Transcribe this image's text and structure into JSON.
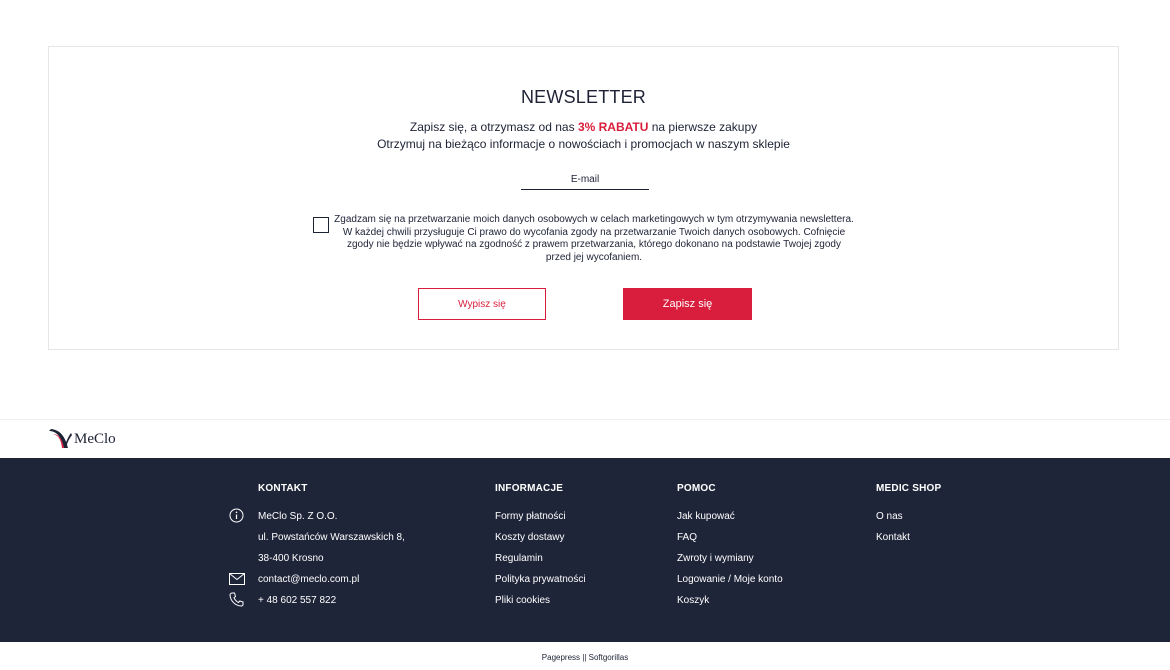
{
  "newsletter": {
    "title": "NEWSLETTER",
    "line1_prefix": "Zapisz się, a otrzymasz od nas ",
    "line1_highlight": "3% RABATU",
    "line1_suffix": " na pierwsze zakupy",
    "line2": "Otrzymuj na bieżąco informacje o nowościach i promocjach w naszym sklepie",
    "email_placeholder": "E-mail",
    "email_value": "",
    "consent_checked": false,
    "consent_text": "Zgadzam się na przetwarzanie moich danych osobowych w celach marketingowych w tym otrzymywania newslettera. W każdej chwili przysługuje Ci prawo do wycofania zgody na przetwarzanie Twoich danych osobowych. Cofnięcie zgody nie będzie wpływać na zgodność z prawem przetwarzania, którego dokonano na podstawie Twojej zgody przed jej wycofaniem.",
    "unsubscribe_label": "Wypisz się",
    "subscribe_label": "Zapisz się"
  },
  "brand": {
    "name": "MeClo"
  },
  "footer": {
    "kontakt": {
      "heading": "KONTAKT",
      "company": "MeClo Sp. Z O.O.",
      "street": "ul. Powstańców Warszawskich 8,",
      "city": "38-400 Krosno",
      "email": "contact@meclo.com.pl",
      "phone": "+ 48 602 557 822"
    },
    "informacje": {
      "heading": "INFORMACJE",
      "items": [
        "Formy płatności",
        "Koszty dostawy",
        "Regulamin",
        "Polityka prywatności",
        "Pliki cookies"
      ]
    },
    "pomoc": {
      "heading": "POMOC",
      "items": [
        "Jak kupować",
        "FAQ",
        "Zwroty i wymiany",
        "Logowanie / Moje konto",
        "Koszyk"
      ]
    },
    "medic_shop": {
      "heading": "MEDIC SHOP",
      "items": [
        "O nas",
        "Kontakt"
      ]
    }
  },
  "credits": "Pagepress || Softgorillas",
  "colors": {
    "accent": "#d81e3c",
    "navy": "#1f2539",
    "text": "#1e2235"
  }
}
